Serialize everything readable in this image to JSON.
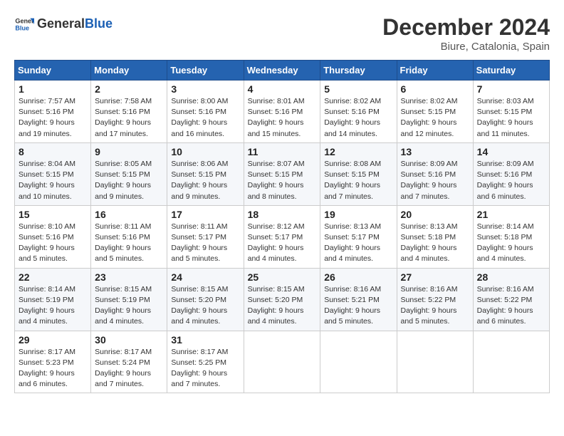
{
  "header": {
    "logo_text_general": "General",
    "logo_text_blue": "Blue",
    "main_title": "December 2024",
    "subtitle": "Biure, Catalonia, Spain"
  },
  "calendar": {
    "days_of_week": [
      "Sunday",
      "Monday",
      "Tuesday",
      "Wednesday",
      "Thursday",
      "Friday",
      "Saturday"
    ],
    "weeks": [
      [
        null,
        {
          "day": "2",
          "sunrise": "7:58 AM",
          "sunset": "5:16 PM",
          "daylight": "9 hours and 17 minutes."
        },
        {
          "day": "3",
          "sunrise": "8:00 AM",
          "sunset": "5:16 PM",
          "daylight": "9 hours and 16 minutes."
        },
        {
          "day": "4",
          "sunrise": "8:01 AM",
          "sunset": "5:16 PM",
          "daylight": "9 hours and 15 minutes."
        },
        {
          "day": "5",
          "sunrise": "8:02 AM",
          "sunset": "5:16 PM",
          "daylight": "9 hours and 14 minutes."
        },
        {
          "day": "6",
          "sunrise": "8:02 AM",
          "sunset": "5:15 PM",
          "daylight": "9 hours and 12 minutes."
        },
        {
          "day": "7",
          "sunrise": "8:03 AM",
          "sunset": "5:15 PM",
          "daylight": "9 hours and 11 minutes."
        }
      ],
      [
        {
          "day": "1",
          "sunrise": "7:57 AM",
          "sunset": "5:16 PM",
          "daylight": "9 hours and 19 minutes."
        },
        null,
        null,
        null,
        null,
        null,
        null
      ],
      [
        {
          "day": "8",
          "sunrise": "8:04 AM",
          "sunset": "5:15 PM",
          "daylight": "9 hours and 10 minutes."
        },
        {
          "day": "9",
          "sunrise": "8:05 AM",
          "sunset": "5:15 PM",
          "daylight": "9 hours and 9 minutes."
        },
        {
          "day": "10",
          "sunrise": "8:06 AM",
          "sunset": "5:15 PM",
          "daylight": "9 hours and 9 minutes."
        },
        {
          "day": "11",
          "sunrise": "8:07 AM",
          "sunset": "5:15 PM",
          "daylight": "9 hours and 8 minutes."
        },
        {
          "day": "12",
          "sunrise": "8:08 AM",
          "sunset": "5:15 PM",
          "daylight": "9 hours and 7 minutes."
        },
        {
          "day": "13",
          "sunrise": "8:09 AM",
          "sunset": "5:16 PM",
          "daylight": "9 hours and 7 minutes."
        },
        {
          "day": "14",
          "sunrise": "8:09 AM",
          "sunset": "5:16 PM",
          "daylight": "9 hours and 6 minutes."
        }
      ],
      [
        {
          "day": "15",
          "sunrise": "8:10 AM",
          "sunset": "5:16 PM",
          "daylight": "9 hours and 5 minutes."
        },
        {
          "day": "16",
          "sunrise": "8:11 AM",
          "sunset": "5:16 PM",
          "daylight": "9 hours and 5 minutes."
        },
        {
          "day": "17",
          "sunrise": "8:11 AM",
          "sunset": "5:17 PM",
          "daylight": "9 hours and 5 minutes."
        },
        {
          "day": "18",
          "sunrise": "8:12 AM",
          "sunset": "5:17 PM",
          "daylight": "9 hours and 4 minutes."
        },
        {
          "day": "19",
          "sunrise": "8:13 AM",
          "sunset": "5:17 PM",
          "daylight": "9 hours and 4 minutes."
        },
        {
          "day": "20",
          "sunrise": "8:13 AM",
          "sunset": "5:18 PM",
          "daylight": "9 hours and 4 minutes."
        },
        {
          "day": "21",
          "sunrise": "8:14 AM",
          "sunset": "5:18 PM",
          "daylight": "9 hours and 4 minutes."
        }
      ],
      [
        {
          "day": "22",
          "sunrise": "8:14 AM",
          "sunset": "5:19 PM",
          "daylight": "9 hours and 4 minutes."
        },
        {
          "day": "23",
          "sunrise": "8:15 AM",
          "sunset": "5:19 PM",
          "daylight": "9 hours and 4 minutes."
        },
        {
          "day": "24",
          "sunrise": "8:15 AM",
          "sunset": "5:20 PM",
          "daylight": "9 hours and 4 minutes."
        },
        {
          "day": "25",
          "sunrise": "8:15 AM",
          "sunset": "5:20 PM",
          "daylight": "9 hours and 4 minutes."
        },
        {
          "day": "26",
          "sunrise": "8:16 AM",
          "sunset": "5:21 PM",
          "daylight": "9 hours and 5 minutes."
        },
        {
          "day": "27",
          "sunrise": "8:16 AM",
          "sunset": "5:22 PM",
          "daylight": "9 hours and 5 minutes."
        },
        {
          "day": "28",
          "sunrise": "8:16 AM",
          "sunset": "5:22 PM",
          "daylight": "9 hours and 6 minutes."
        }
      ],
      [
        {
          "day": "29",
          "sunrise": "8:17 AM",
          "sunset": "5:23 PM",
          "daylight": "9 hours and 6 minutes."
        },
        {
          "day": "30",
          "sunrise": "8:17 AM",
          "sunset": "5:24 PM",
          "daylight": "9 hours and 7 minutes."
        },
        {
          "day": "31",
          "sunrise": "8:17 AM",
          "sunset": "5:25 PM",
          "daylight": "9 hours and 7 minutes."
        },
        null,
        null,
        null,
        null
      ]
    ]
  }
}
